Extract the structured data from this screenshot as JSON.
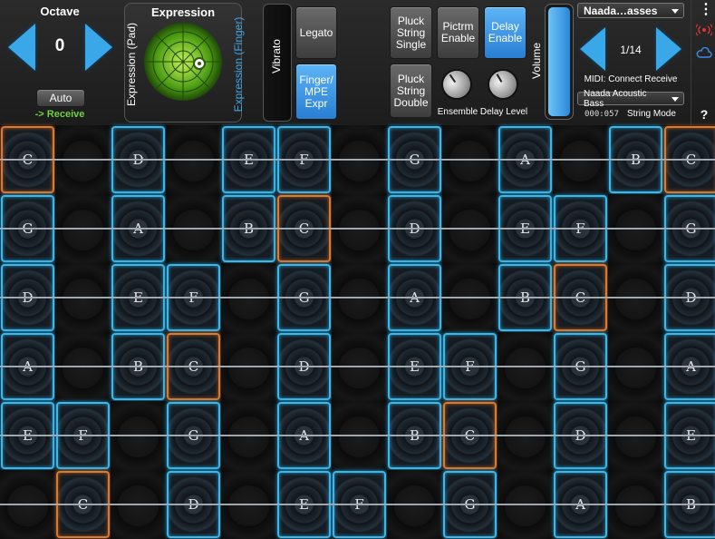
{
  "octave": {
    "title": "Octave",
    "value": "0",
    "auto_label": "Auto",
    "receive_label": "-> Receive"
  },
  "expression": {
    "title": "Expression",
    "pad_label": "Expression (Pad)",
    "finger_label": "Expression (Finger)"
  },
  "vibrato": {
    "label": "Vibrato"
  },
  "buttons": {
    "legato": "Legato",
    "finger_mpe": "Finger/\nMPE\nExpr",
    "pluck_single": "Pluck\nString\nSingle",
    "pictrm": "Pictrm\nEnable",
    "delay_enable": "Delay\nEnable",
    "pluck_double": "Pluck\nString\nDouble"
  },
  "knobs": {
    "ensemble": "Ensemble",
    "delay_level": "Delay Level"
  },
  "volume": {
    "label": "Volume"
  },
  "preset": {
    "name": "Naada…asses",
    "counter": "1/14",
    "midi": "MIDI: Connect Receive",
    "instrument": "Naada Acoustic Bass",
    "time": "000:057",
    "mode": "String Mode"
  },
  "side": {
    "menu_icon": "⋮",
    "help": "?"
  },
  "colors": {
    "accent_blue": "#3fb6e6",
    "root_orange": "#d87a32",
    "receive_green": "#6fd23a",
    "active_button": "#3d9be8"
  },
  "grid": [
    [
      "C",
      "",
      "D",
      "",
      "E",
      "F",
      "",
      "G",
      "",
      "A",
      "",
      "B",
      "C"
    ],
    [
      "G",
      "",
      "A",
      "",
      "B",
      "C",
      "",
      "D",
      "",
      "E",
      "F",
      "",
      "G"
    ],
    [
      "D",
      "",
      "E",
      "F",
      "",
      "G",
      "",
      "A",
      "",
      "B",
      "C",
      "",
      "D"
    ],
    [
      "A",
      "",
      "B",
      "C",
      "",
      "D",
      "",
      "E",
      "F",
      "",
      "G",
      "",
      "A"
    ],
    [
      "E",
      "F",
      "",
      "G",
      "",
      "A",
      "",
      "B",
      "C",
      "",
      "D",
      "",
      "E"
    ],
    [
      "",
      "C",
      "",
      "D",
      "",
      "E",
      "F",
      "",
      "G",
      "",
      "A",
      "",
      "B"
    ]
  ],
  "root_note": "C"
}
